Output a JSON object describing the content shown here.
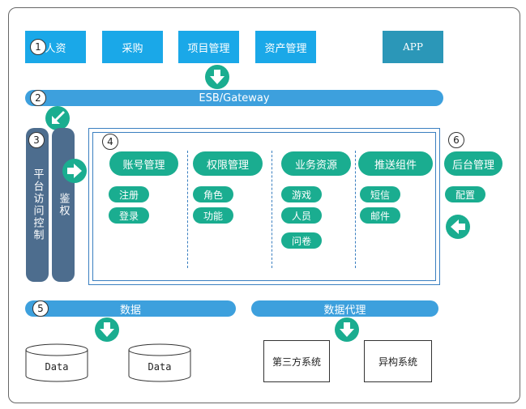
{
  "top_modules": {
    "hr": "人资",
    "purchase": "采购",
    "project": "项目管理",
    "asset": "资产管理",
    "app": "APP"
  },
  "numbers": {
    "n1": "1",
    "n2": "2",
    "n3": "3",
    "n4": "4",
    "n5": "5",
    "n6": "6"
  },
  "esb": "ESB/Gateway",
  "left_columns": {
    "platform_access": "平台访问控制",
    "auth": "鉴权"
  },
  "modules": {
    "account": {
      "title": "账号管理",
      "items": [
        "注册",
        "登录"
      ]
    },
    "permission": {
      "title": "权限管理",
      "items": [
        "角色",
        "功能"
      ]
    },
    "business": {
      "title": "业务资源",
      "items": [
        "游戏",
        "人员",
        "问卷"
      ]
    },
    "push": {
      "title": "推送组件",
      "items": [
        "短信",
        "邮件"
      ]
    }
  },
  "backend": {
    "title": "后台管理",
    "item": "配置"
  },
  "data_bar": "数据",
  "proxy_bar": "数据代理",
  "databases": [
    "Data",
    "Data"
  ],
  "external": {
    "third_party": "第三方系统",
    "heterogeneous": "异构系统"
  },
  "colors": {
    "top_box": "#1aa8e8",
    "app_box": "#2b97b8",
    "bar": "#3da0dd",
    "column": "#4d6d8e",
    "pill": "#1aad90",
    "frame": "#3a7fc0"
  }
}
